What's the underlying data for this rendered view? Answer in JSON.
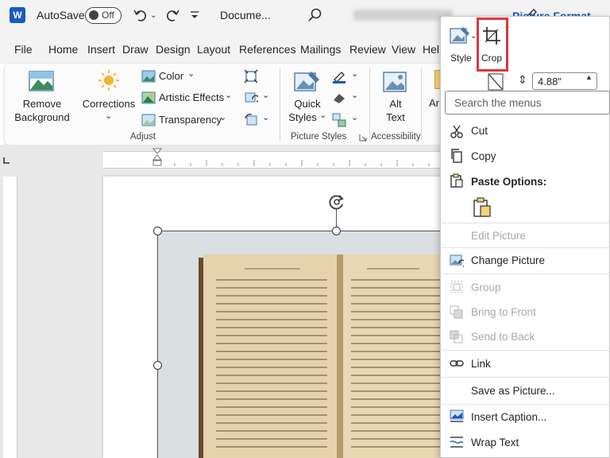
{
  "titlebar": {
    "app_logo": "W",
    "autosave_label": "AutoSave",
    "autosave_state": "Off",
    "doc_title": "Docume...",
    "icons": [
      "undo-icon",
      "redo-icon",
      "search-icon",
      "pen-icon"
    ]
  },
  "tabs": [
    "File",
    "Home",
    "Insert",
    "Draw",
    "Design",
    "Layout",
    "References",
    "Mailings",
    "Review",
    "View",
    "Hel"
  ],
  "active_tab": "Picture Format",
  "ribbon": {
    "remove_background": [
      "Remove",
      "Background"
    ],
    "corrections": "Corrections",
    "color": "Color",
    "artistic_effects": "Artistic Effects",
    "transparency": "Transparency",
    "adjust_label": "Adjust",
    "quick_styles": [
      "Quick",
      "Styles"
    ],
    "picture_styles_label": "Picture Styles",
    "alt_text": [
      "Alt",
      "Text"
    ],
    "accessibility_label": "Accessibility",
    "arrange_partial": "Ar",
    "size_value": "4.88\""
  },
  "mini_toolbar": {
    "style": "Style",
    "crop": "Crop"
  },
  "menu": {
    "search_placeholder": "Search the menus",
    "cut": "Cut",
    "copy": "Copy",
    "paste_options": "Paste Options:",
    "edit_picture": "Edit Picture",
    "change_picture": "Change Picture",
    "group": "Group",
    "bring_to_front": "Bring to Front",
    "send_to_back": "Send to Back",
    "link": "Link",
    "save_as_picture": "Save as Picture...",
    "insert_caption": "Insert Caption...",
    "wrap_text": "Wrap Text"
  },
  "colors": {
    "accent": "#185abd",
    "highlight": "#e0353b"
  }
}
